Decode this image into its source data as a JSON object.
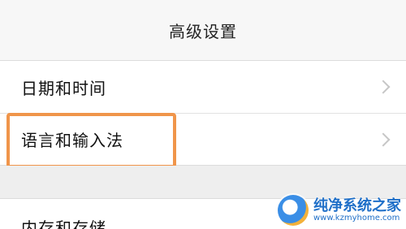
{
  "header": {
    "title": "高级设置"
  },
  "settings": {
    "items": [
      {
        "label": "日期和时间"
      },
      {
        "label": "语言和输入法"
      }
    ],
    "bottom_item": {
      "label": "内存和存储"
    }
  },
  "highlight": {
    "color": "#f0954a",
    "target": "语言和输入法"
  },
  "watermark": {
    "name": "纯净系统之家",
    "url": "www.kzmyhome.com",
    "icon": "logo-icon"
  }
}
